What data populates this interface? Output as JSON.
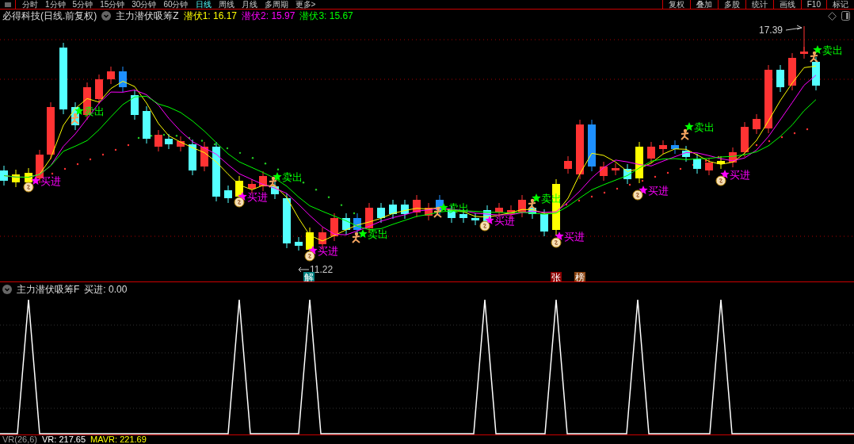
{
  "toolbar": {
    "periods": [
      {
        "label": "分时",
        "selected": false
      },
      {
        "label": "1分钟",
        "selected": false
      },
      {
        "label": "5分钟",
        "selected": false
      },
      {
        "label": "15分钟",
        "selected": false
      },
      {
        "label": "30分钟",
        "selected": false
      },
      {
        "label": "60分钟",
        "selected": false
      },
      {
        "label": "日线",
        "selected": true
      },
      {
        "label": "周线",
        "selected": false
      },
      {
        "label": "月线",
        "selected": false
      },
      {
        "label": "多周期",
        "selected": false
      },
      {
        "label": "更多>",
        "selected": false
      }
    ],
    "tools": [
      "复权",
      "叠加",
      "多股",
      "统计",
      "画线",
      "F10",
      "标记"
    ]
  },
  "main_panel": {
    "stock": "必得科技(日线.前复权)",
    "indicator": "主力潜伏吸筹Z",
    "readings": [
      {
        "label": "潜伏1: 16.17",
        "color": "#ffff00"
      },
      {
        "label": "潜伏2: 15.97",
        "color": "#ff00ff"
      },
      {
        "label": "潜伏3: 15.67",
        "color": "#00ff00"
      }
    ],
    "high_label": "17.39",
    "low_label": "11.22",
    "signals": [
      {
        "kind": "buy",
        "label": "买进"
      },
      {
        "kind": "sell",
        "label": "卖出"
      },
      {
        "kind": "buy",
        "label": "买进"
      },
      {
        "kind": "sell",
        "label": "卖出"
      },
      {
        "kind": "buy",
        "label": "买进"
      },
      {
        "kind": "sell",
        "label": "卖出"
      },
      {
        "kind": "sell",
        "label": "卖出"
      },
      {
        "kind": "buy",
        "label": "买进"
      },
      {
        "kind": "sell",
        "label": "卖出"
      },
      {
        "kind": "buy",
        "label": "买进"
      },
      {
        "kind": "buy",
        "label": "买进"
      },
      {
        "kind": "sell",
        "label": "卖出"
      },
      {
        "kind": "buy",
        "label": "买进"
      },
      {
        "kind": "sell",
        "label": "卖出"
      }
    ],
    "badges": [
      {
        "label": "解",
        "color": "#008080"
      },
      {
        "label": "张",
        "color": "#8b0000"
      },
      {
        "label": "榜",
        "color": "#8b4513"
      }
    ]
  },
  "sub_panel": {
    "indicator": "主力潜伏吸筹F",
    "reading": "买进: 0.00"
  },
  "bottom_panel": {
    "indicator": "VR(26,6)",
    "readings": [
      {
        "label": "VR: 217.65",
        "color": "#ffffff"
      },
      {
        "label": "MAVR: 221.69",
        "color": "#ffff00"
      }
    ]
  }
}
